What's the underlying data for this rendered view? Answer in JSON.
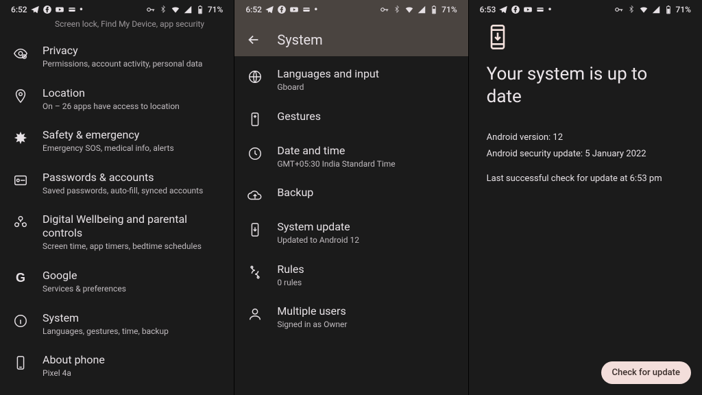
{
  "statusbars": [
    {
      "time": "6:52",
      "battery": "71%"
    },
    {
      "time": "6:52",
      "battery": "71%"
    },
    {
      "time": "6:53",
      "battery": "71%"
    }
  ],
  "phone1": {
    "truncated": "Screen lock, Find My Device, app security",
    "items": [
      {
        "title": "Privacy",
        "sub": "Permissions, account activity, personal data"
      },
      {
        "title": "Location",
        "sub": "On – 26 apps have access to location"
      },
      {
        "title": "Safety & emergency",
        "sub": "Emergency SOS, medical info, alerts"
      },
      {
        "title": "Passwords & accounts",
        "sub": "Saved passwords, auto-fill, synced accounts"
      },
      {
        "title": "Digital Wellbeing and parental controls",
        "sub": "Screen time, app timers, bedtime schedules"
      },
      {
        "title": "Google",
        "sub": "Services & preferences"
      },
      {
        "title": "System",
        "sub": "Languages, gestures, time, backup"
      },
      {
        "title": "About phone",
        "sub": "Pixel 4a"
      }
    ]
  },
  "phone2": {
    "title": "System",
    "items": [
      {
        "title": "Languages and input",
        "sub": "Gboard"
      },
      {
        "title": "Gestures",
        "sub": ""
      },
      {
        "title": "Date and time",
        "sub": "GMT+05:30 India Standard Time"
      },
      {
        "title": "Backup",
        "sub": ""
      },
      {
        "title": "System update",
        "sub": "Updated to Android 12"
      },
      {
        "title": "Rules",
        "sub": "0 rules"
      },
      {
        "title": "Multiple users",
        "sub": "Signed in as Owner"
      }
    ]
  },
  "phone3": {
    "headline": "Your system is up to date",
    "line1": "Android version: 12",
    "line2": "Android security update: 5 January 2022",
    "line3": "Last successful check for update at 6:53 pm",
    "button": "Check for update"
  }
}
